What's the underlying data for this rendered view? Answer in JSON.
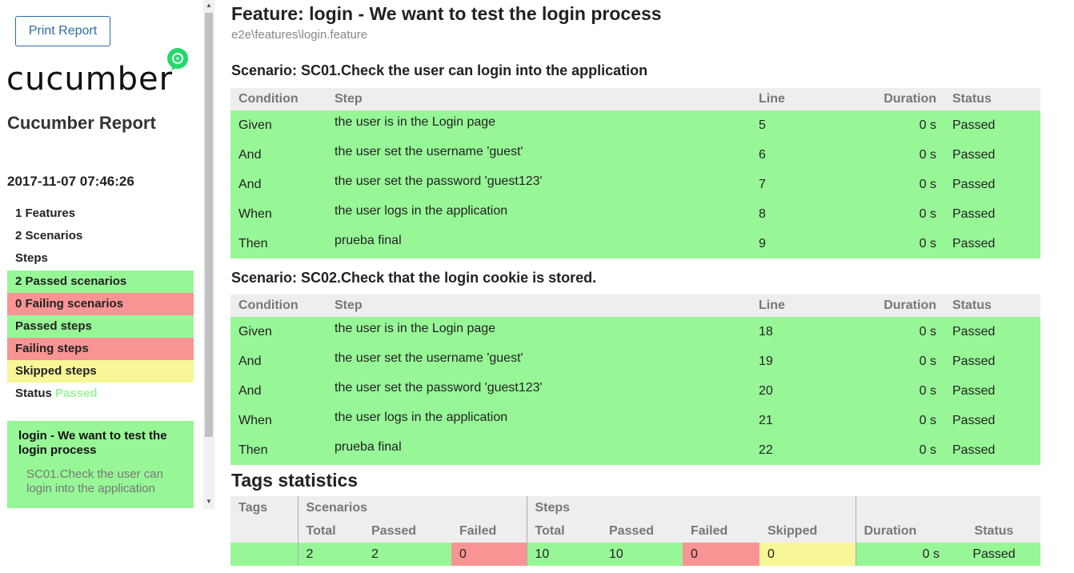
{
  "sidebar": {
    "print_label": "Print Report",
    "logo_text": "cucumber",
    "title": "Cucumber Report",
    "date": "2017-11-07 07:46:26",
    "stats": {
      "features": "1 Features",
      "scenarios": "2 Scenarios",
      "steps": "Steps",
      "passed_scenarios": "2 Passed scenarios",
      "failing_scenarios": "0 Failing scenarios",
      "passed_steps": "Passed steps",
      "failing_steps": "Failing steps",
      "skipped_steps": "Skipped steps",
      "status_label": "Status",
      "status_value": "Passed"
    },
    "feature_card": {
      "name": "login - We want to test the login process",
      "scenario": "SC01.Check the user can login into the application"
    }
  },
  "main": {
    "feature_title": "Feature: login - We want to test the login process",
    "feature_path": "e2e\\features\\login.feature",
    "columns": [
      "Condition",
      "Step",
      "Line",
      "Duration",
      "Status"
    ],
    "scenarios": [
      {
        "title": "Scenario: SC01.Check the user can login into the application",
        "rows": [
          {
            "condition": "Given",
            "step": "the user is in the Login page",
            "line": "5",
            "duration": "0 s",
            "status": "Passed"
          },
          {
            "condition": "And",
            "step": "the user set the username 'guest'",
            "line": "6",
            "duration": "0 s",
            "status": "Passed"
          },
          {
            "condition": "And",
            "step": "the user set the password 'guest123'",
            "line": "7",
            "duration": "0 s",
            "status": "Passed"
          },
          {
            "condition": "When",
            "step": "the user logs in the application",
            "line": "8",
            "duration": "0 s",
            "status": "Passed"
          },
          {
            "condition": "Then",
            "step": "prueba final",
            "line": "9",
            "duration": "0 s",
            "status": "Passed"
          }
        ]
      },
      {
        "title": "Scenario: SC02.Check that the login cookie is stored.",
        "rows": [
          {
            "condition": "Given",
            "step": "the user is in the Login page",
            "line": "18",
            "duration": "0 s",
            "status": "Passed"
          },
          {
            "condition": "And",
            "step": "the user set the username 'guest'",
            "line": "19",
            "duration": "0 s",
            "status": "Passed"
          },
          {
            "condition": "And",
            "step": "the user set the password 'guest123'",
            "line": "20",
            "duration": "0 s",
            "status": "Passed"
          },
          {
            "condition": "When",
            "step": "the user logs in the application",
            "line": "21",
            "duration": "0 s",
            "status": "Passed"
          },
          {
            "condition": "Then",
            "step": "prueba final",
            "line": "22",
            "duration": "0 s",
            "status": "Passed"
          }
        ]
      }
    ],
    "tags": {
      "title": "Tags statistics",
      "group_headers": {
        "tags": "Tags",
        "scenarios": "Scenarios",
        "steps": "Steps"
      },
      "sub_headers": {
        "sc_total": "Total",
        "sc_passed": "Passed",
        "sc_failed": "Failed",
        "st_total": "Total",
        "st_passed": "Passed",
        "st_failed": "Failed",
        "st_skipped": "Skipped",
        "duration": "Duration",
        "status": "Status"
      },
      "row": {
        "sc_total": "2",
        "sc_passed": "2",
        "sc_failed": "0",
        "st_total": "10",
        "st_passed": "10",
        "st_failed": "0",
        "st_skipped": "0",
        "duration": "0 s",
        "status": "Passed"
      }
    }
  },
  "colors": {
    "passed": "#97f797",
    "failed": "#f99494",
    "skipped": "#f7f797",
    "header": "#eeeeee",
    "link": "#2e6da4"
  }
}
